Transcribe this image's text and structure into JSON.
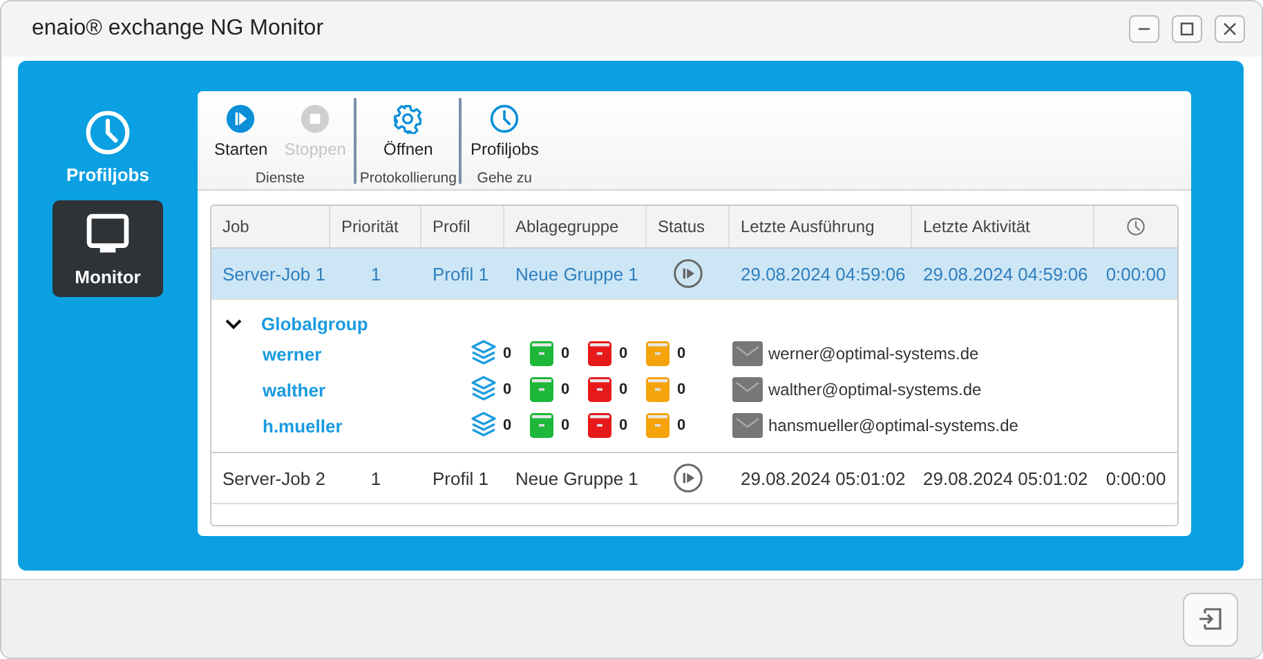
{
  "window": {
    "title": "enaio® exchange NG Monitor"
  },
  "sidebar": {
    "items": [
      {
        "label": "Profiljobs",
        "kind": "clock",
        "selected": false
      },
      {
        "label": "Monitor",
        "kind": "monitor",
        "selected": true
      }
    ]
  },
  "toolbar": {
    "groups": [
      {
        "label": "Dienste",
        "buttons": [
          {
            "label": "Starten",
            "kind": "start",
            "disabled": false
          },
          {
            "label": "Stoppen",
            "kind": "stop",
            "disabled": true
          }
        ]
      },
      {
        "label": "Protokollierung",
        "buttons": [
          {
            "label": "Öffnen",
            "kind": "gear",
            "disabled": false
          }
        ]
      },
      {
        "label": "Gehe zu",
        "buttons": [
          {
            "label": "Profiljobs",
            "kind": "clock",
            "disabled": false
          }
        ]
      }
    ]
  },
  "table": {
    "columns": [
      "Job",
      "Priorität",
      "Profil",
      "Ablagegruppe",
      "Status",
      "Letzte Ausführung",
      "Letzte Aktivität"
    ],
    "rows": [
      {
        "job": "Server-Job 1",
        "priority": "1",
        "profile": "Profil 1",
        "group": "Neue Gruppe 1",
        "last_run": "29.08.2024 04:59:06",
        "last_activity": "29.08.2024 04:59:06",
        "duration": "0:00:00",
        "selected": true,
        "details": {
          "name": "Globalgroup",
          "expanded": true,
          "users": [
            {
              "name": "werner",
              "email": "werner@optimal-systems.de",
              "counters": [
                {
                  "kind": "stack",
                  "value": "0"
                },
                {
                  "kind": "box",
                  "color": "#1db83a",
                  "value": "0"
                },
                {
                  "kind": "box",
                  "color": "#e8191b",
                  "value": "0"
                },
                {
                  "kind": "box",
                  "color": "#f5a30c",
                  "value": "0"
                }
              ]
            },
            {
              "name": "walther",
              "email": "walther@optimal-systems.de",
              "counters": [
                {
                  "kind": "stack",
                  "value": "0"
                },
                {
                  "kind": "box",
                  "color": "#1db83a",
                  "value": "0"
                },
                {
                  "kind": "box",
                  "color": "#e8191b",
                  "value": "0"
                },
                {
                  "kind": "box",
                  "color": "#f5a30c",
                  "value": "0"
                }
              ]
            },
            {
              "name": "h.mueller",
              "email": "hansmueller@optimal-systems.de",
              "counters": [
                {
                  "kind": "stack",
                  "value": "0"
                },
                {
                  "kind": "box",
                  "color": "#1db83a",
                  "value": "0"
                },
                {
                  "kind": "box",
                  "color": "#e8191b",
                  "value": "0"
                },
                {
                  "kind": "box",
                  "color": "#f5a30c",
                  "value": "0"
                }
              ]
            }
          ]
        }
      },
      {
        "job": "Server-Job 2",
        "priority": "1",
        "profile": "Profil 1",
        "group": "Neue Gruppe 1",
        "last_run": "29.08.2024 05:01:02",
        "last_activity": "29.08.2024 05:01:02",
        "duration": "0:00:00",
        "selected": false
      }
    ]
  }
}
